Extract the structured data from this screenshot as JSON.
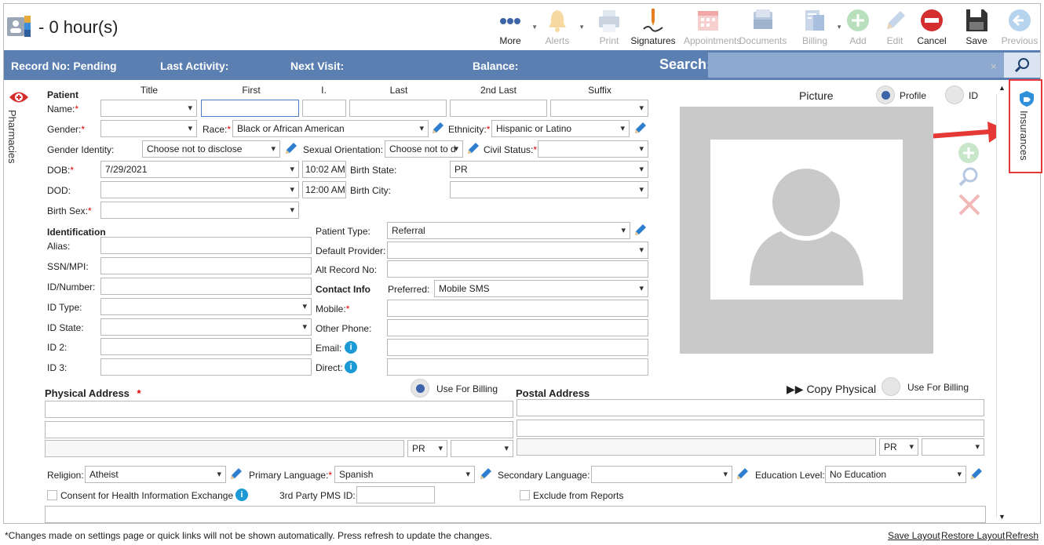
{
  "header": {
    "title": "- 0 hour(s)"
  },
  "toolbar": [
    {
      "key": "more",
      "label": "More",
      "icon": "more-dots-icon",
      "enabled": true,
      "dropdown": true
    },
    {
      "key": "alerts",
      "label": "Alerts",
      "icon": "bell-icon",
      "enabled": false,
      "dropdown": true
    },
    {
      "key": "print",
      "label": "Print",
      "icon": "printer-icon",
      "enabled": false
    },
    {
      "key": "signatures",
      "label": "Signatures",
      "icon": "signature-pen-icon",
      "enabled": true
    },
    {
      "key": "appointments",
      "label": "Appointments",
      "icon": "calendar-icon",
      "enabled": false
    },
    {
      "key": "documents",
      "label": "Documents",
      "icon": "documents-icon",
      "enabled": false
    },
    {
      "key": "billing",
      "label": "Billing",
      "icon": "billing-icon",
      "enabled": false,
      "dropdown": true
    },
    {
      "key": "add",
      "label": "Add",
      "icon": "plus-circle-icon",
      "enabled": false
    },
    {
      "key": "edit",
      "label": "Edit",
      "icon": "pencil-icon",
      "enabled": false
    },
    {
      "key": "cancel",
      "label": "Cancel",
      "icon": "minus-circle-icon",
      "enabled": true
    },
    {
      "key": "save",
      "label": "Save",
      "icon": "floppy-disk-icon",
      "enabled": true
    },
    {
      "key": "previous",
      "label": "Previous",
      "icon": "arrow-left-circle-icon",
      "enabled": false
    }
  ],
  "infobar": {
    "record_no": "Record No: Pending",
    "last_activity": "Last Activity:",
    "next_visit": "Next Visit:",
    "balance": "Balance:",
    "search_label": "Search:",
    "search_value": "",
    "search_clear": "×"
  },
  "sidebar": {
    "pharmacies": "Pharmacies",
    "insurances": "Insurances"
  },
  "patient": {
    "section": "Patient",
    "col_headers": {
      "title": "Title",
      "first": "First",
      "initial": "I.",
      "last": "Last",
      "second_last": "2nd Last",
      "suffix": "Suffix"
    },
    "name_label": "Name:",
    "gender_label": "Gender:",
    "gender": "",
    "race_label": "Race:",
    "race": "Black or African American",
    "ethnicity_label": "Ethnicity:",
    "ethnicity": "Hispanic or Latino",
    "gender_identity_label": "Gender Identity:",
    "gender_identity": "Choose not to disclose",
    "sexual_orientation_label": "Sexual Orientation:",
    "sexual_orientation": "Choose not to d",
    "civil_status_label": "Civil Status:",
    "civil_status": "",
    "dob_label": "DOB:",
    "dob": "7/29/2021",
    "dob_time": "10:02 AM",
    "birth_state_label": "Birth State:",
    "birth_state": "PR",
    "dod_label": "DOD:",
    "dod": "",
    "dod_time": "12:00 AM",
    "birth_city_label": "Birth City:",
    "birth_city": "",
    "birth_sex_label": "Birth Sex:",
    "birth_sex": ""
  },
  "identification": {
    "section": "Identification",
    "alias_label": "Alias:",
    "ssn_label": "SSN/MPI:",
    "id_number_label": "ID/Number:",
    "id_type_label": "ID Type:",
    "id_state_label": "ID State:",
    "id2_label": "ID 2:",
    "id3_label": "ID 3:"
  },
  "right_fields": {
    "patient_type_label": "Patient Type:",
    "patient_type": "Referral",
    "default_provider_label": "Default Provider:",
    "default_provider": "",
    "alt_record_label": "Alt Record No:",
    "contact_info": "Contact Info",
    "preferred_label": "Preferred:",
    "preferred": "Mobile SMS",
    "mobile_label": "Mobile:",
    "other_phone_label": "Other Phone:",
    "email_label": "Email:",
    "direct_label": "Direct:"
  },
  "picture": {
    "label": "Picture",
    "profile": "Profile",
    "id": "ID",
    "selected": "Profile"
  },
  "address": {
    "physical": "Physical Address",
    "postal": "Postal Address",
    "use_for_billing": "Use For Billing",
    "copy_physical": "Copy Physical",
    "physical_state": "PR",
    "postal_state": "PR"
  },
  "bottom": {
    "religion_label": "Religion:",
    "religion": "Atheist",
    "primary_language_label": "Primary Language:",
    "primary_language": "Spanish",
    "secondary_language_label": "Secondary Language:",
    "secondary_language": "",
    "education_label": "Education Level:",
    "education": "No Education",
    "consent": "Consent for Health Information Exchange",
    "third_party_label": "3rd Party PMS ID:",
    "exclude": "Exclude from Reports"
  },
  "footer": {
    "note": "*Changes made on settings page or quick links will not be shown automatically. Press refresh to update the changes.",
    "save_layout": "Save Layout",
    "restore_layout": "Restore Layout",
    "refresh": "Refresh"
  },
  "colors": {
    "infobar": "#5b7fb1",
    "search": "#8ea9d0",
    "accent": "#3d63a8",
    "required": "#dd0000",
    "highlight": "#e53935"
  }
}
